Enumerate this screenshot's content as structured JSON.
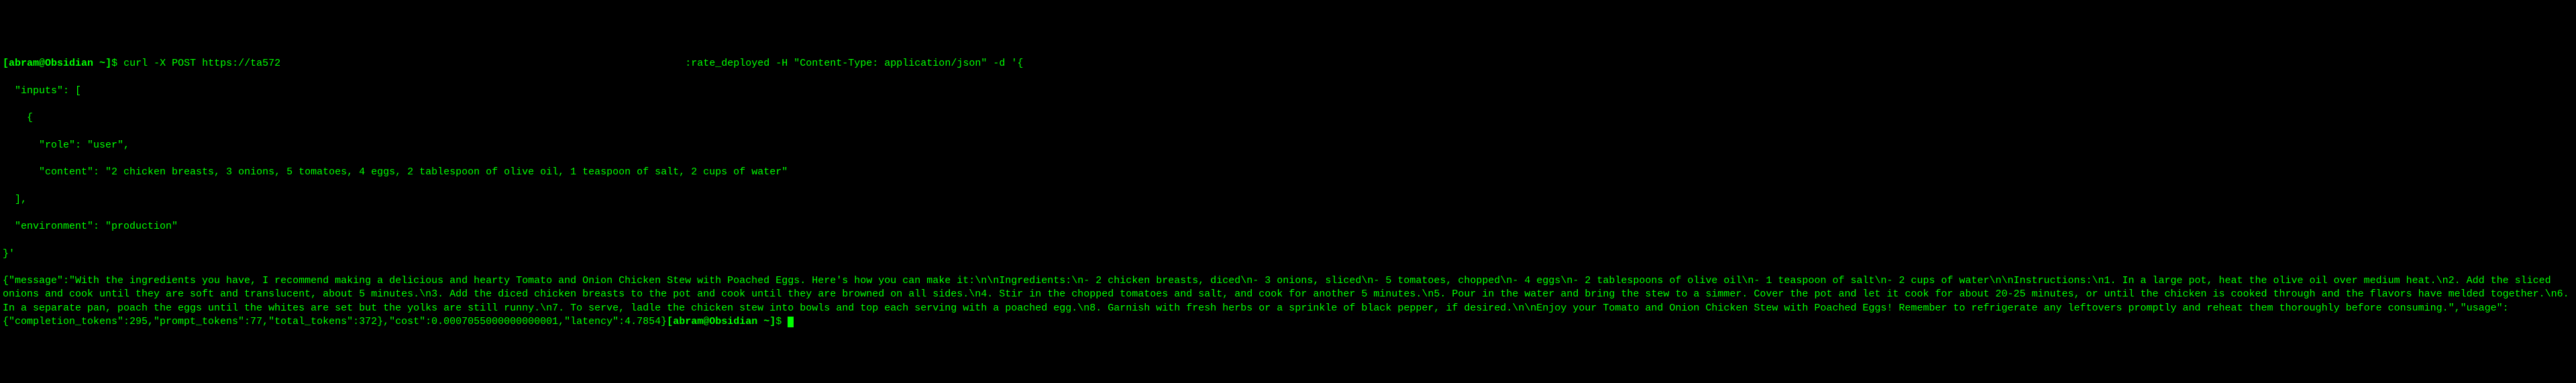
{
  "prompt": {
    "open_bracket": "[",
    "user_host": "abram@Obsidian",
    "tilde": " ~",
    "close_bracket": "]",
    "dollar": "$ "
  },
  "command": {
    "part1": "curl -X POST https://ta572",
    "redacted1": "                  ",
    "part2": "                                                 ",
    "part3": ":rate_deployed -H \"Content-Type: application/json\" -d '{"
  },
  "request_body": {
    "line1": "  \"inputs\": [",
    "line2": "    {",
    "line3": "      \"role\": \"user\",",
    "line4": "      \"content\": \"2 chicken breasts, 3 onions, 5 tomatoes, 4 eggs, 2 tablespoon of olive oil, 1 teaspoon of salt, 2 cups of water\"",
    "line5": "  ],",
    "line6": "  \"environment\": \"production\"",
    "line7": "}'"
  },
  "response": {
    "text": "{\"message\":\"With the ingredients you have, I recommend making a delicious and hearty Tomato and Onion Chicken Stew with Poached Eggs. Here's how you can make it:\\n\\nIngredients:\\n- 2 chicken breasts, diced\\n- 3 onions, sliced\\n- 5 tomatoes, chopped\\n- 4 eggs\\n- 2 tablespoons of olive oil\\n- 1 teaspoon of salt\\n- 2 cups of water\\n\\nInstructions:\\n1. In a large pot, heat the olive oil over medium heat.\\n2. Add the sliced onions and cook until they are soft and translucent, about 5 minutes.\\n3. Add the diced chicken breasts to the pot and cook until they are browned on all sides.\\n4. Stir in the chopped tomatoes and salt, and cook for another 5 minutes.\\n5. Pour in the water and bring the stew to a simmer. Cover the pot and let it cook for about 20-25 minutes, or until the chicken is cooked through and the flavors have melded together.\\n6. In a separate pan, poach the eggs until the whites are set but the yolks are still runny.\\n7. To serve, ladle the chicken stew into bowls and top each serving with a poached egg.\\n8. Garnish with fresh herbs or a sprinkle of black pepper, if desired.\\n\\nEnjoy your Tomato and Onion Chicken Stew with Poached Eggs! Remember to refrigerate any leftovers promptly and reheat them thoroughly before consuming.\",\"usage\":{\"completion_tokens\":295,\"prompt_tokens\":77,\"total_tokens\":372},\"cost\":0.0007055000000000001,\"latency\":4.7854}"
  },
  "prompt2": {
    "open_bracket": "[",
    "user_host": "abram@Obsidian",
    "tilde": " ~",
    "close_bracket": "]",
    "dollar": "$ "
  }
}
